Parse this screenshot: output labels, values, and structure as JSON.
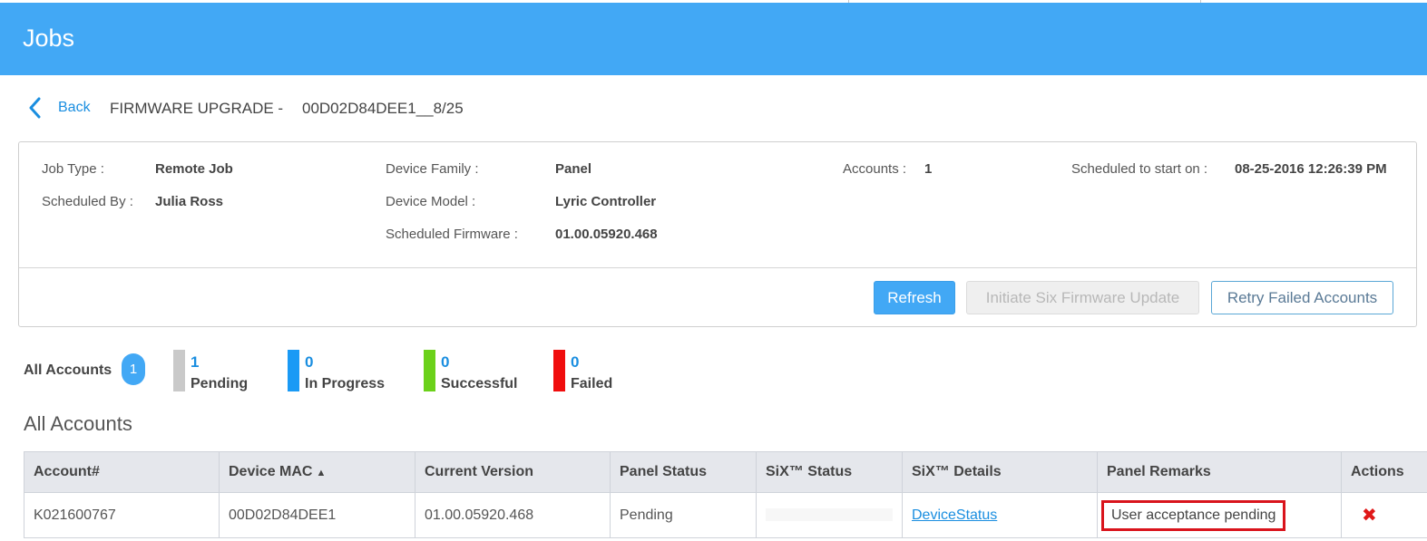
{
  "header": {
    "title": "Jobs"
  },
  "crumb": {
    "back_label": "Back",
    "job_name": "FIRMWARE UPGRADE -",
    "job_id": "00D02D84DEE1__8/25"
  },
  "details": {
    "job_type_label": "Job Type :",
    "job_type": "Remote Job",
    "scheduled_by_label": "Scheduled By :",
    "scheduled_by": "Julia Ross",
    "device_family_label": "Device Family :",
    "device_family": "Panel",
    "device_model_label": "Device Model :",
    "device_model": "Lyric Controller",
    "scheduled_firmware_label": "Scheduled Firmware :",
    "scheduled_firmware": "01.00.05920.468",
    "accounts_label": "Accounts :",
    "accounts": "1",
    "scheduled_start_label": "Scheduled to start on :",
    "scheduled_start": "08-25-2016 12:26:39 PM"
  },
  "actions": {
    "refresh": "Refresh",
    "initiate": "Initiate Six Firmware Update",
    "retry": "Retry Failed Accounts"
  },
  "filters": {
    "all_label": "All Accounts",
    "all_count": "1",
    "stats": [
      {
        "count": "1",
        "label": "Pending",
        "color": "#c9c9c9"
      },
      {
        "count": "0",
        "label": "In Progress",
        "color": "#1a9af5"
      },
      {
        "count": "0",
        "label": "Successful",
        "color": "#6bd11a"
      },
      {
        "count": "0",
        "label": "Failed",
        "color": "#f00d0d"
      }
    ]
  },
  "section_title": "All Accounts",
  "table": {
    "columns": [
      "Account#",
      "Device MAC",
      "Current Version",
      "Panel Status",
      "SiX™ Status",
      "SiX™ Details",
      "Panel Remarks",
      "Actions"
    ],
    "sort_arrow": "▲",
    "rows": [
      {
        "account": "K021600767",
        "mac": "00D02D84DEE1",
        "version": "01.00.05920.468",
        "panel_status": "Pending",
        "six_status": "",
        "six_details": "DeviceStatus",
        "remarks": "User acceptance pending",
        "action_icon": "✖"
      }
    ]
  }
}
